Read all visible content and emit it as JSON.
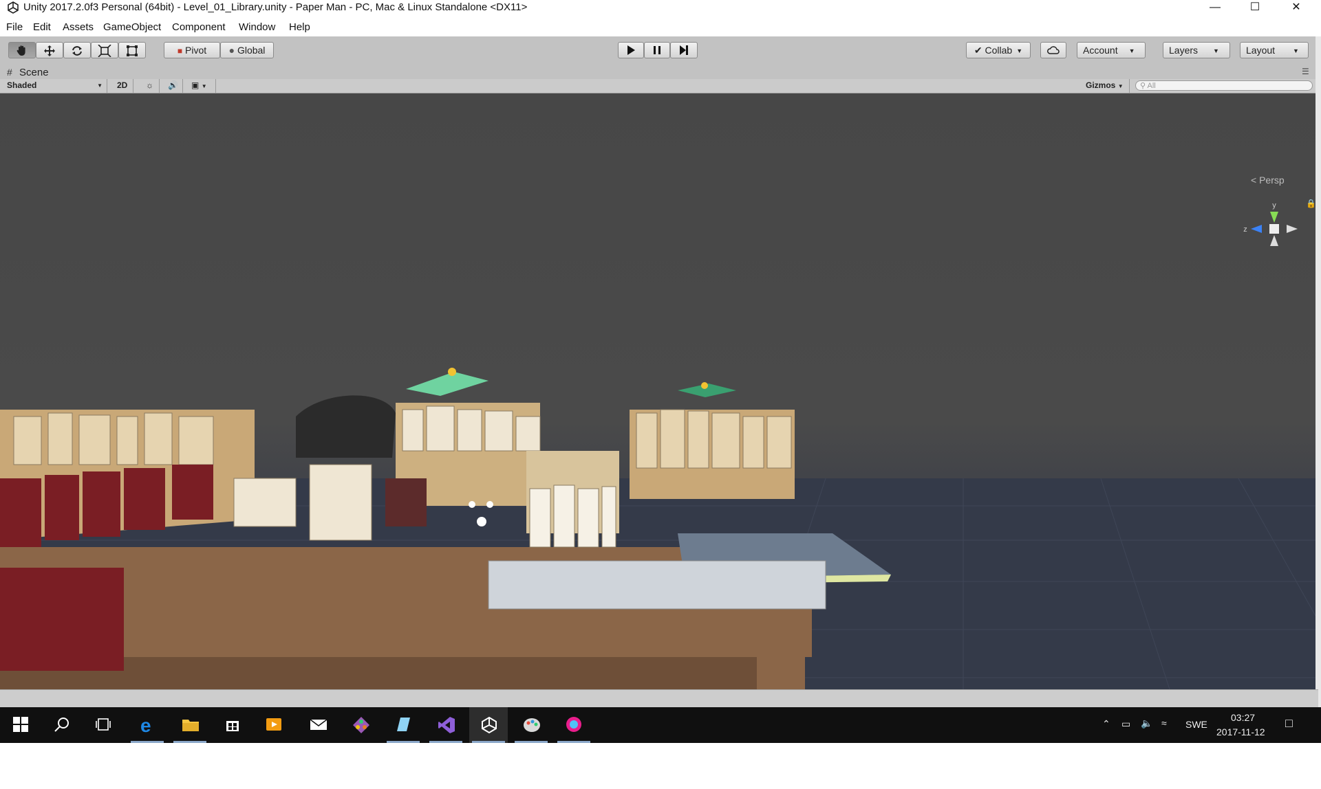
{
  "window": {
    "title": "Unity 2017.2.0f3 Personal (64bit) - Level_01_Library.unity - Paper Man - PC, Mac & Linux Standalone <DX11>",
    "minimize_icon": "minimize-icon",
    "maximize_icon": "maximize-icon",
    "close_icon": "close-icon"
  },
  "menu": [
    "File",
    "Edit",
    "Assets",
    "GameObject",
    "Component",
    "Window",
    "Help"
  ],
  "toolbar": {
    "tools": [
      "hand-tool-icon",
      "move-tool-icon",
      "rotate-tool-icon",
      "scale-tool-icon",
      "rect-tool-icon"
    ],
    "pivot_label": "Pivot",
    "global_label": "Global",
    "play_icon": "play-icon",
    "pause_icon": "pause-icon",
    "step_icon": "step-icon",
    "collab_label": "Collab",
    "cloud_icon": "cloud-icon",
    "account_label": "Account",
    "layers_label": "Layers",
    "layout_label": "Layout"
  },
  "scene": {
    "tab_label": "Scene",
    "draw_mode": "Shaded",
    "mode_2d": "2D",
    "gizmos_label": "Gizmos",
    "search_placeholder": "All",
    "persp_label": "Persp",
    "axis_y": "y",
    "axis_z": "z"
  },
  "taskbar": {
    "apps": [
      "windows-start-icon",
      "search-icon",
      "task-view-icon",
      "edge-icon",
      "file-explorer-icon",
      "store-icon",
      "media-player-icon",
      "mail-icon",
      "git-icon",
      "notes-icon",
      "visual-studio-icon",
      "unity-icon",
      "paint-icon",
      "color-picker-icon"
    ],
    "language": "SWE",
    "time": "03:27",
    "date": "2017-11-12"
  },
  "colors": {
    "toolbar_bg": "#c2c2c2",
    "viewport_bg": "#474747",
    "taskbar_bg": "#101010"
  }
}
